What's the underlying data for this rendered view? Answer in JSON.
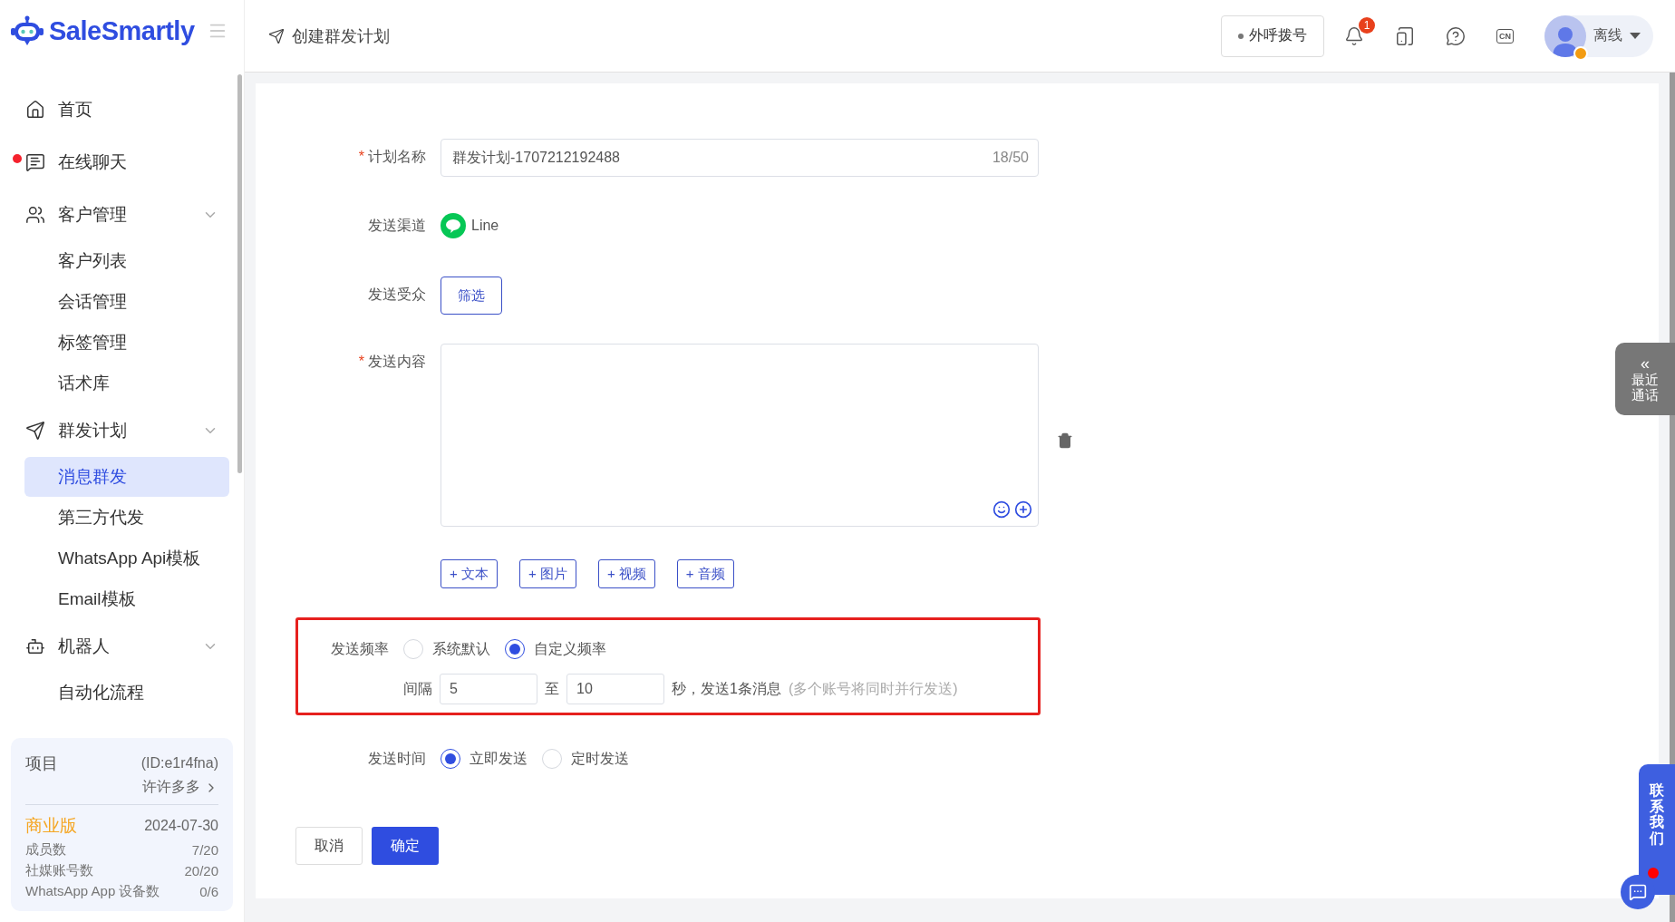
{
  "brand": {
    "name": "SaleSmartly"
  },
  "header": {
    "title": "创建群发计划",
    "dial_button": "外呼拨号",
    "notification_count": "1",
    "language": "CN",
    "user_status": "离线"
  },
  "sidebar": {
    "items": [
      {
        "label": "首页",
        "unread": false,
        "selected": false
      },
      {
        "label": "在线聊天",
        "unread": true,
        "selected": false
      },
      {
        "label": "客户管理",
        "unread": false,
        "expanded": true,
        "children": [
          {
            "label": "客户列表",
            "selected": false
          },
          {
            "label": "会话管理",
            "selected": false
          },
          {
            "label": "标签管理",
            "selected": false
          },
          {
            "label": "话术库",
            "selected": false
          }
        ]
      },
      {
        "label": "群发计划",
        "unread": false,
        "expanded": true,
        "children": [
          {
            "label": "消息群发",
            "selected": true
          },
          {
            "label": "第三方代发",
            "selected": false
          },
          {
            "label": "WhatsApp Api模板",
            "selected": false
          },
          {
            "label": "Email模板",
            "selected": false
          }
        ]
      },
      {
        "label": "机器人",
        "unread": false,
        "expanded": true,
        "children": [
          {
            "label": "自动化流程",
            "selected": false
          }
        ]
      }
    ],
    "project_card": {
      "label": "项目",
      "id": "(ID:e1r4fna)",
      "owner": "许许多多",
      "plan": "商业版",
      "expiry": "2024-07-30",
      "stats": [
        {
          "label": "成员数",
          "value": "7/20"
        },
        {
          "label": "社媒账号数",
          "value": "20/20"
        },
        {
          "label": "WhatsApp App 设备数",
          "value": "0/6"
        }
      ]
    }
  },
  "form": {
    "required_mark": "*",
    "name": {
      "label": "计划名称",
      "required": true,
      "value": "群发计划-1707212192488",
      "counter": "18/50"
    },
    "channel": {
      "label": "发送渠道",
      "required": false,
      "value": "Line"
    },
    "audience": {
      "label": "发送受众",
      "required": false,
      "button": "筛选"
    },
    "content": {
      "label": "发送内容",
      "required": true
    },
    "add_buttons": [
      "+ 文本",
      "+ 图片",
      "+ 视频",
      "+ 音频"
    ],
    "frequency": {
      "label": "发送频率",
      "required": false,
      "highlighted": true,
      "options": [
        {
          "label": "系统默认",
          "selected": false
        },
        {
          "label": "自定义频率",
          "selected": true
        }
      ],
      "interval_label": "间隔",
      "min": "5",
      "to": "至",
      "max": "10",
      "suffix": "秒，发送1条消息",
      "note": "(多个账号将同时并行发送)"
    },
    "time": {
      "label": "发送时间",
      "required": false,
      "options": [
        {
          "label": "立即发送",
          "selected": true
        },
        {
          "label": "定时发送",
          "selected": false
        }
      ]
    },
    "actions": {
      "cancel": "取消",
      "confirm": "确定"
    }
  },
  "side_tabs": {
    "recent_calls": {
      "arrow": "«",
      "label": "最近通话"
    },
    "contact": {
      "label": "联系我们",
      "unread": true
    }
  }
}
